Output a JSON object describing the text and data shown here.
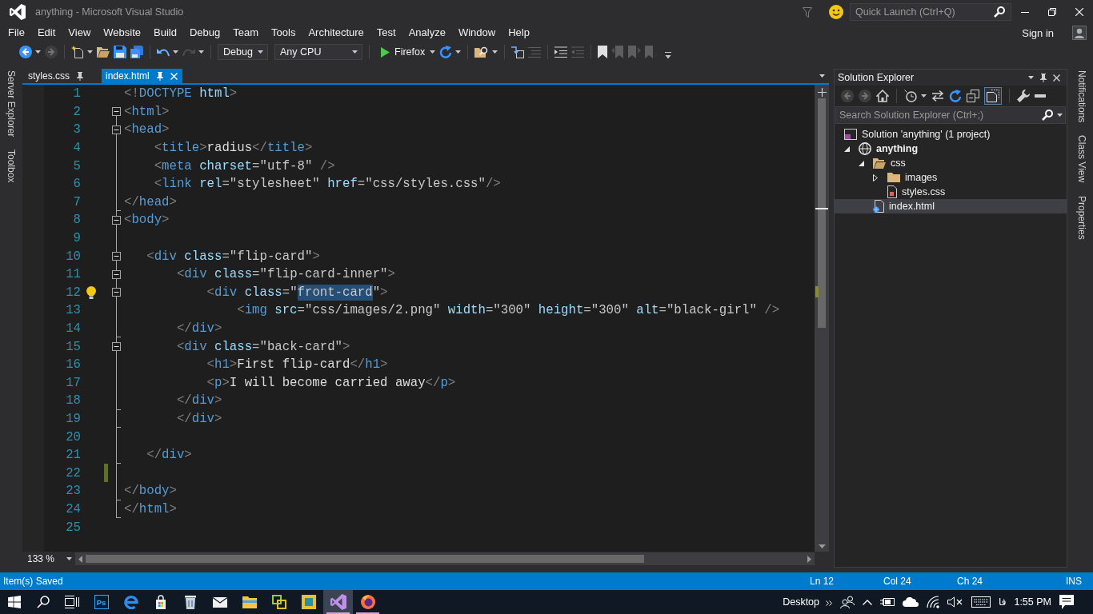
{
  "window": {
    "title": "anything - Microsoft Visual Studio",
    "quick_launch": {
      "placeholder": "Quick Launch (Ctrl+Q)"
    }
  },
  "menu": {
    "items": [
      "File",
      "Edit",
      "View",
      "Website",
      "Build",
      "Debug",
      "Team",
      "Tools",
      "Architecture",
      "Test",
      "Analyze",
      "Window",
      "Help"
    ],
    "sign_in": "Sign in"
  },
  "toolbar": {
    "groups": [
      [
        {
          "kind": "back",
          "disabled": false
        },
        {
          "kind": "forward",
          "disabled": true
        }
      ],
      [
        {
          "kind": "new",
          "disabled": false
        },
        {
          "kind": "open",
          "disabled": false
        },
        {
          "kind": "save",
          "disabled": false
        },
        {
          "kind": "save-all",
          "disabled": false
        }
      ],
      [
        {
          "kind": "undo",
          "disabled": false
        },
        {
          "kind": "redo",
          "disabled": true
        }
      ],
      [
        {
          "kind": "dropdown",
          "label": "Debug",
          "disabled": false
        },
        {
          "kind": "dropdown",
          "label": "Any CPU",
          "disabled": false
        }
      ],
      [
        {
          "kind": "run",
          "label": "Firefox",
          "disabled": false
        },
        {
          "kind": "refresh",
          "disabled": false
        }
      ],
      [
        {
          "kind": "find",
          "disabled": false
        }
      ],
      [
        {
          "kind": "step",
          "disabled": false
        },
        {
          "kind": "lines",
          "disabled": true
        }
      ],
      [
        {
          "kind": "indent",
          "disabled": false
        },
        {
          "kind": "outdent",
          "disabled": true
        }
      ],
      [
        {
          "kind": "bookmark",
          "disabled": false
        },
        {
          "kind": "bookmark-prev",
          "disabled": true
        },
        {
          "kind": "bookmark-next",
          "disabled": true
        },
        {
          "kind": "bookmark-clear",
          "disabled": true
        }
      ]
    ]
  },
  "left_dock_tabs": [
    "Server Explorer",
    "Toolbox"
  ],
  "document_tabs": [
    {
      "label": "styles.css",
      "selected": false
    },
    {
      "label": "index.html",
      "selected": true
    }
  ],
  "editor": {
    "zoom": "133 %",
    "lines": [
      {
        "number": "1",
        "segments": [
          {
            "text": "<!DOCTYPE html>",
            "selected": false
          }
        ],
        "collapsible": false,
        "block_end": false,
        "hint": false,
        "modified": false
      },
      {
        "number": "2",
        "segments": [
          {
            "text": "<html>",
            "selected": false
          }
        ],
        "collapsible": true,
        "block_end": false,
        "hint": false,
        "modified": false
      },
      {
        "number": "3",
        "segments": [
          {
            "text": "<head>",
            "selected": false
          }
        ],
        "collapsible": true,
        "block_end": false,
        "hint": false,
        "modified": false
      },
      {
        "number": "4",
        "segments": [
          {
            "text": "    <title>radius</title>",
            "selected": false
          }
        ],
        "collapsible": false,
        "block_end": false,
        "hint": false,
        "modified": false
      },
      {
        "number": "5",
        "segments": [
          {
            "text": "    <meta charset=\"utf-8\" />",
            "selected": false
          }
        ],
        "collapsible": false,
        "block_end": false,
        "hint": false,
        "modified": false
      },
      {
        "number": "6",
        "segments": [
          {
            "text": "    <link rel=\"stylesheet\" href=\"css/styles.css\"/>",
            "selected": false
          }
        ],
        "collapsible": false,
        "block_end": false,
        "hint": false,
        "modified": false
      },
      {
        "number": "7",
        "segments": [
          {
            "text": "</head>",
            "selected": false
          }
        ],
        "collapsible": false,
        "block_end": true,
        "hint": false,
        "modified": false
      },
      {
        "number": "8",
        "segments": [
          {
            "text": "<body>",
            "selected": false
          }
        ],
        "collapsible": true,
        "block_end": false,
        "hint": false,
        "modified": false
      },
      {
        "number": "9",
        "collapsible": false,
        "block_end": false,
        "hint": false,
        "modified": false
      },
      {
        "number": "10",
        "segments": [
          {
            "text": "   <div class=\"flip-card\">",
            "selected": false
          }
        ],
        "collapsible": true,
        "block_end": false,
        "hint": false,
        "modified": false
      },
      {
        "number": "11",
        "segments": [
          {
            "text": "       <div class=\"flip-card-inner\">",
            "selected": false
          }
        ],
        "collapsible": true,
        "block_end": false,
        "hint": false,
        "modified": false
      },
      {
        "number": "12",
        "segments": [
          {
            "text": "           <div class=\"",
            "selected": false
          },
          {
            "text": "front-card",
            "selected": true
          },
          {
            "text": "\">",
            "selected": false
          }
        ],
        "collapsible": true,
        "block_end": false,
        "hint": true,
        "modified": false
      },
      {
        "number": "13",
        "segments": [
          {
            "text": "               <img src=\"css/images/2.png\" width=\"300\" height=\"300\" alt=\"black-girl\" />",
            "selected": false
          }
        ],
        "collapsible": false,
        "block_end": false,
        "hint": false,
        "modified": false
      },
      {
        "number": "14",
        "segments": [
          {
            "text": "       </div>",
            "selected": false
          }
        ],
        "collapsible": false,
        "block_end": true,
        "hint": false,
        "modified": false
      },
      {
        "number": "15",
        "segments": [
          {
            "text": "       <div class=\"back-card\">",
            "selected": false
          }
        ],
        "collapsible": true,
        "block_end": false,
        "hint": false,
        "modified": false
      },
      {
        "number": "16",
        "segments": [
          {
            "text": "           <h1>First flip-card</h1>",
            "selected": false
          }
        ],
        "collapsible": false,
        "block_end": false,
        "hint": false,
        "modified": false
      },
      {
        "number": "17",
        "segments": [
          {
            "text": "           <p>I will become carried away</p>",
            "selected": false
          }
        ],
        "collapsible": false,
        "block_end": false,
        "hint": false,
        "modified": false
      },
      {
        "number": "18",
        "segments": [
          {
            "text": "       </div>",
            "selected": false
          }
        ],
        "collapsible": false,
        "block_end": true,
        "hint": false,
        "modified": false
      },
      {
        "number": "19",
        "segments": [
          {
            "text": "       </div>",
            "selected": false
          }
        ],
        "collapsible": false,
        "block_end": true,
        "hint": false,
        "modified": false
      },
      {
        "number": "20",
        "collapsible": false,
        "block_end": false,
        "hint": false,
        "modified": false
      },
      {
        "number": "21",
        "segments": [
          {
            "text": "   </div>",
            "selected": false
          }
        ],
        "collapsible": false,
        "block_end": true,
        "hint": false,
        "modified": false
      },
      {
        "number": "22",
        "collapsible": false,
        "block_end": false,
        "hint": false,
        "modified": true
      },
      {
        "number": "23",
        "segments": [
          {
            "text": "</body>",
            "selected": false
          }
        ],
        "collapsible": false,
        "block_end": true,
        "hint": false,
        "modified": false
      },
      {
        "number": "24",
        "segments": [
          {
            "text": "</html>",
            "selected": false
          }
        ],
        "collapsible": false,
        "block_end": true,
        "hint": false,
        "modified": false
      },
      {
        "number": "25",
        "collapsible": false,
        "block_end": false,
        "hint": false,
        "modified": false
      }
    ]
  },
  "solution_explorer": {
    "title": "Solution Explorer",
    "toolbar": [
      {
        "kind": "back",
        "disabled": true,
        "pressed": false
      },
      {
        "kind": "forward",
        "disabled": true,
        "pressed": false
      },
      {
        "kind": "home",
        "disabled": false,
        "pressed": false
      },
      {
        "kind": "history",
        "disabled": false,
        "pressed": false
      },
      {
        "kind": "sync",
        "disabled": false,
        "pressed": false
      },
      {
        "kind": "refresh",
        "disabled": false,
        "pressed": false
      },
      {
        "kind": "collapse",
        "disabled": false,
        "pressed": false
      },
      {
        "kind": "show-all",
        "disabled": false,
        "pressed": true
      },
      {
        "kind": "properties",
        "disabled": false,
        "pressed": false
      },
      {
        "kind": "preview",
        "disabled": false,
        "pressed": false
      }
    ],
    "search": {
      "placeholder": "Search Solution Explorer (Ctrl+;)"
    },
    "tree": [
      {
        "label": "Solution 'anything' (1 project)",
        "kind": "solution",
        "selected": false,
        "children": [
          {
            "label": "anything",
            "kind": "project",
            "expanded": true,
            "selected": false,
            "children": [
              {
                "label": "css",
                "kind": "folder",
                "expanded": true,
                "selected": false,
                "children": [
                  {
                    "label": "images",
                    "kind": "folder",
                    "expanded": false,
                    "selected": false
                  },
                  {
                    "label": "styles.css",
                    "kind": "css-file",
                    "selected": false
                  }
                ]
              },
              {
                "label": "index.html",
                "kind": "html-file",
                "selected": true
              }
            ]
          }
        ]
      }
    ]
  },
  "right_dock_tabs": [
    "Notifications",
    "Class View",
    "Properties"
  ],
  "status_bar": {
    "message": "Item(s) Saved",
    "line": "Ln 12",
    "column": "Col 24",
    "character": "Ch 24",
    "mode": "INS"
  },
  "taskbar": {
    "apps": [
      {
        "kind": "photoshop",
        "label": "Ps",
        "active": false,
        "running": false
      },
      {
        "kind": "edge",
        "active": false,
        "running": false
      },
      {
        "kind": "store",
        "active": false,
        "running": false
      },
      {
        "kind": "bin",
        "active": false,
        "running": false
      },
      {
        "kind": "mail",
        "active": false,
        "running": false
      },
      {
        "kind": "explorer",
        "active": false,
        "running": false
      },
      {
        "kind": "linked",
        "active": false,
        "running": false
      },
      {
        "kind": "tile",
        "active": false,
        "running": false
      },
      {
        "kind": "studio",
        "active": true,
        "running": true
      },
      {
        "kind": "firefox",
        "active": false,
        "running": true
      }
    ],
    "toolbar_label": "Desktop",
    "language": "فا",
    "time": "1:55 PM"
  }
}
